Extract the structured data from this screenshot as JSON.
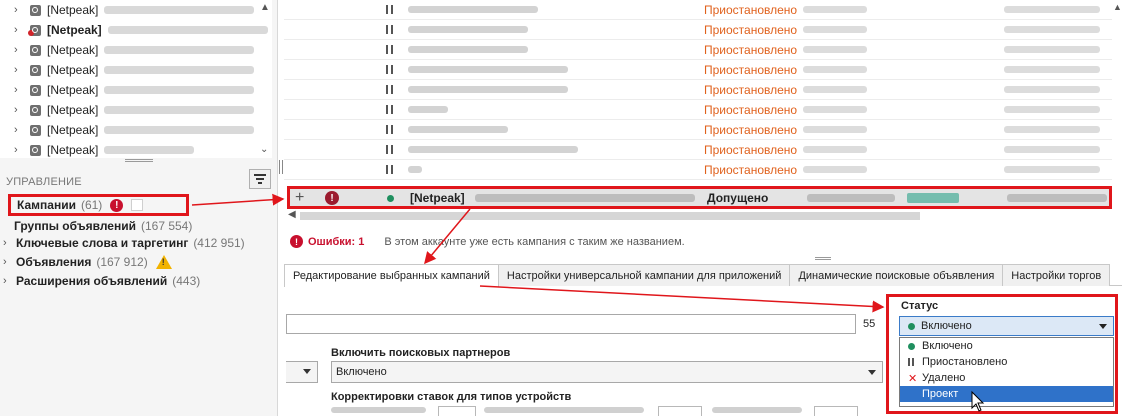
{
  "tree": {
    "items": [
      {
        "label": "[Netpeak]",
        "bold": false,
        "blur": 150,
        "alert": false
      },
      {
        "label": "[Netpeak]",
        "bold": true,
        "blur": 160,
        "alert": true
      },
      {
        "label": "[Netpeak]",
        "bold": false,
        "blur": 150,
        "alert": false
      },
      {
        "label": "[Netpeak]",
        "bold": false,
        "blur": 150,
        "alert": false
      },
      {
        "label": "[Netpeak]",
        "bold": false,
        "blur": 150,
        "alert": false
      },
      {
        "label": "[Netpeak]",
        "bold": false,
        "blur": 150,
        "alert": false
      },
      {
        "label": "[Netpeak]",
        "bold": false,
        "blur": 150,
        "alert": false
      },
      {
        "label": "[Netpeak]",
        "bold": false,
        "blur": 90,
        "alert": false
      }
    ]
  },
  "management": {
    "title": "УПРАВЛЕНИЕ",
    "items": [
      {
        "label": "Кампании",
        "count": "(61)"
      },
      {
        "label": "Группы объявлений",
        "count": "(167 554)"
      },
      {
        "label": "Ключевые слова и таргетинг",
        "count": "(412 951)"
      },
      {
        "label": "Объявления",
        "count": "(167 912)"
      },
      {
        "label": "Расширения объявлений",
        "count": "(443)"
      }
    ]
  },
  "grid": {
    "rows": [
      {
        "status": "Приостановлено",
        "blur": 130
      },
      {
        "status": "Приостановлено",
        "blur": 120
      },
      {
        "status": "Приостановлено",
        "blur": 120
      },
      {
        "status": "Приостановлено",
        "blur": 160
      },
      {
        "status": "Приостановлено",
        "blur": 160
      },
      {
        "status": "Приостановлено",
        "blur": 40
      },
      {
        "status": "Приостановлено",
        "blur": 100
      },
      {
        "status": "Приостановлено",
        "blur": 170
      },
      {
        "status": "Приостановлено",
        "blur": 14
      }
    ],
    "selected": {
      "name": "[Netpeak]",
      "status": "Допущено"
    }
  },
  "errors": {
    "label": "Ошибки: 1",
    "message": "В этом аккаунте уже есть кампания с таким же названием."
  },
  "tabs": [
    "Редактирование выбранных кампаний",
    "Настройки универсальной кампании для приложений",
    "Динамические поисковые объявления",
    "Настройки торгов"
  ],
  "editor": {
    "name_count": "55",
    "partners_label": "Включить поисковых партнеров",
    "partners_value": "Включено",
    "bids_label": "Корректировки ставок для типов устройств"
  },
  "status": {
    "label": "Статус",
    "selected": "Включено",
    "options": [
      {
        "label": "Включено",
        "icon": "green-dot-icon"
      },
      {
        "label": "Приостановлено",
        "icon": "pause-icon"
      },
      {
        "label": "Удалено",
        "icon": "red-x-icon"
      },
      {
        "label": "Проект",
        "icon": "none",
        "highlighted": true
      }
    ]
  },
  "colors": {
    "accent_red": "#e0161b",
    "paused_orange": "#e0611c",
    "selection_blue": "#2f72c9",
    "enabled_green": "#1f8f5f"
  }
}
